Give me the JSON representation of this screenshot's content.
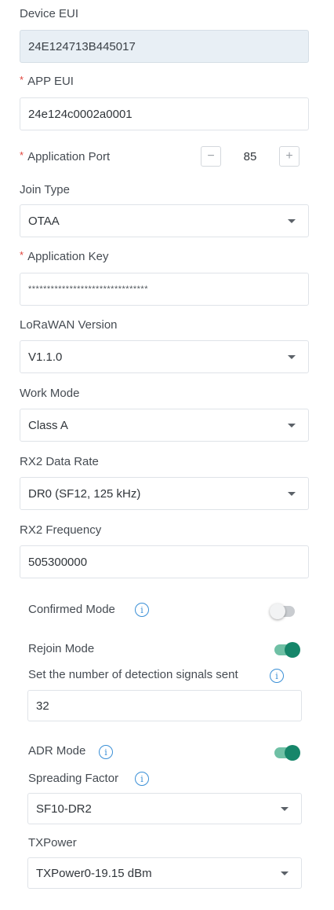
{
  "device_eui": {
    "label": "Device EUI",
    "value": "24E124713B445017"
  },
  "app_eui": {
    "required_mark": "*",
    "label": "APP EUI",
    "value": "24e124c0002a0001"
  },
  "application_port": {
    "required_mark": "*",
    "label": "Application Port",
    "value": "85",
    "minus": "−",
    "plus": "+"
  },
  "join_type": {
    "label": "Join Type",
    "value": "OTAA"
  },
  "application_key": {
    "required_mark": "*",
    "label": "Application Key",
    "value": "********************************"
  },
  "lorawan_version": {
    "label": "LoRaWAN Version",
    "value": "V1.1.0"
  },
  "work_mode": {
    "label": "Work Mode",
    "value": "Class A"
  },
  "rx2_data_rate": {
    "label": "RX2 Data Rate",
    "value": "DR0 (SF12, 125 kHz)"
  },
  "rx2_frequency": {
    "label": "RX2 Frequency",
    "value": "505300000"
  },
  "confirmed_mode": {
    "label": "Confirmed Mode",
    "info": "i",
    "enabled": false
  },
  "rejoin_mode": {
    "label": "Rejoin Mode",
    "enabled": true
  },
  "detection_signals": {
    "label": "Set the number of detection signals  sent",
    "info": "i",
    "value": "32"
  },
  "adr_mode": {
    "label": "ADR Mode",
    "info": "i",
    "enabled": true
  },
  "spreading_factor": {
    "label": "Spreading Factor",
    "info": "i",
    "value": "SF10-DR2"
  },
  "tx_power": {
    "label": "TXPower",
    "value": "TXPower0-19.15 dBm"
  },
  "colors": {
    "accent": "#16866a",
    "info": "#3a8fd6",
    "required": "#e0443c",
    "readonly_bg": "#e8eff5"
  }
}
